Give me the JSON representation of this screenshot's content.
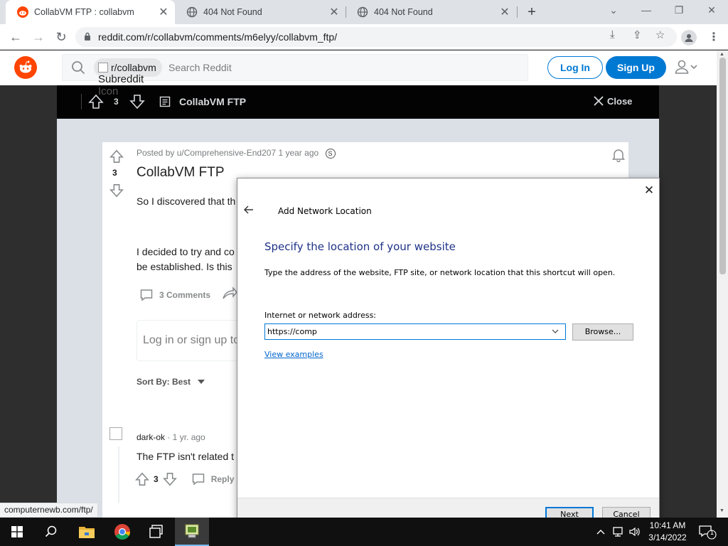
{
  "browser": {
    "tabs": [
      {
        "title": "CollabVM FTP : collabvm",
        "active": true
      },
      {
        "title": "404 Not Found",
        "active": false
      },
      {
        "title": "404 Not Found",
        "active": false
      }
    ],
    "url": "reddit.com/r/collabvm/comments/m6elyy/collabvm_ftp/",
    "status_url": "computernewb.com/ftp/"
  },
  "reddit": {
    "search_chip": "r/collabvm",
    "chip_alt_line1": "Subreddit",
    "chip_alt_line2": "Icon",
    "search_placeholder": "Search Reddit",
    "login_label": "Log In",
    "signup_label": "Sign Up",
    "post_bar": {
      "score": "3",
      "title": "CollabVM FTP",
      "close_label": "Close"
    },
    "post": {
      "score": "3",
      "posted_by": "Posted by u/Comprehensive-End207 1 year ago",
      "title": "CollabVM FTP",
      "para1": "So I discovered that th",
      "para2_line1": "I decided to try and co",
      "para2_line2": "be established. Is this",
      "comments_label": "3 Comments",
      "login_prompt": "Log in or sign up to",
      "sort_label": "Sort By: Best"
    },
    "comment": {
      "author": "dark-ok",
      "time": " · 1 yr. ago",
      "text": "The FTP isn't related t",
      "score": "3",
      "reply_label": "Reply"
    }
  },
  "dialog": {
    "caption": "Add Network Location",
    "heading": "Specify the location of your website",
    "description": "Type the address of the website, FTP site, or network location that this shortcut will open.",
    "address_label": "Internet or network address:",
    "address_value": "https://comp",
    "browse_label": "Browse...",
    "examples_link": "View examples",
    "next_label": "Next",
    "cancel_label": "Cancel"
  },
  "taskbar": {
    "time": "10:41 AM",
    "date": "3/14/2022",
    "notification_count": "1"
  },
  "colors": {
    "reddit_orange": "#ff4500",
    "reddit_blue": "#0079d3",
    "dialog_heading": "#1e3287",
    "accent": "#0078d7"
  }
}
